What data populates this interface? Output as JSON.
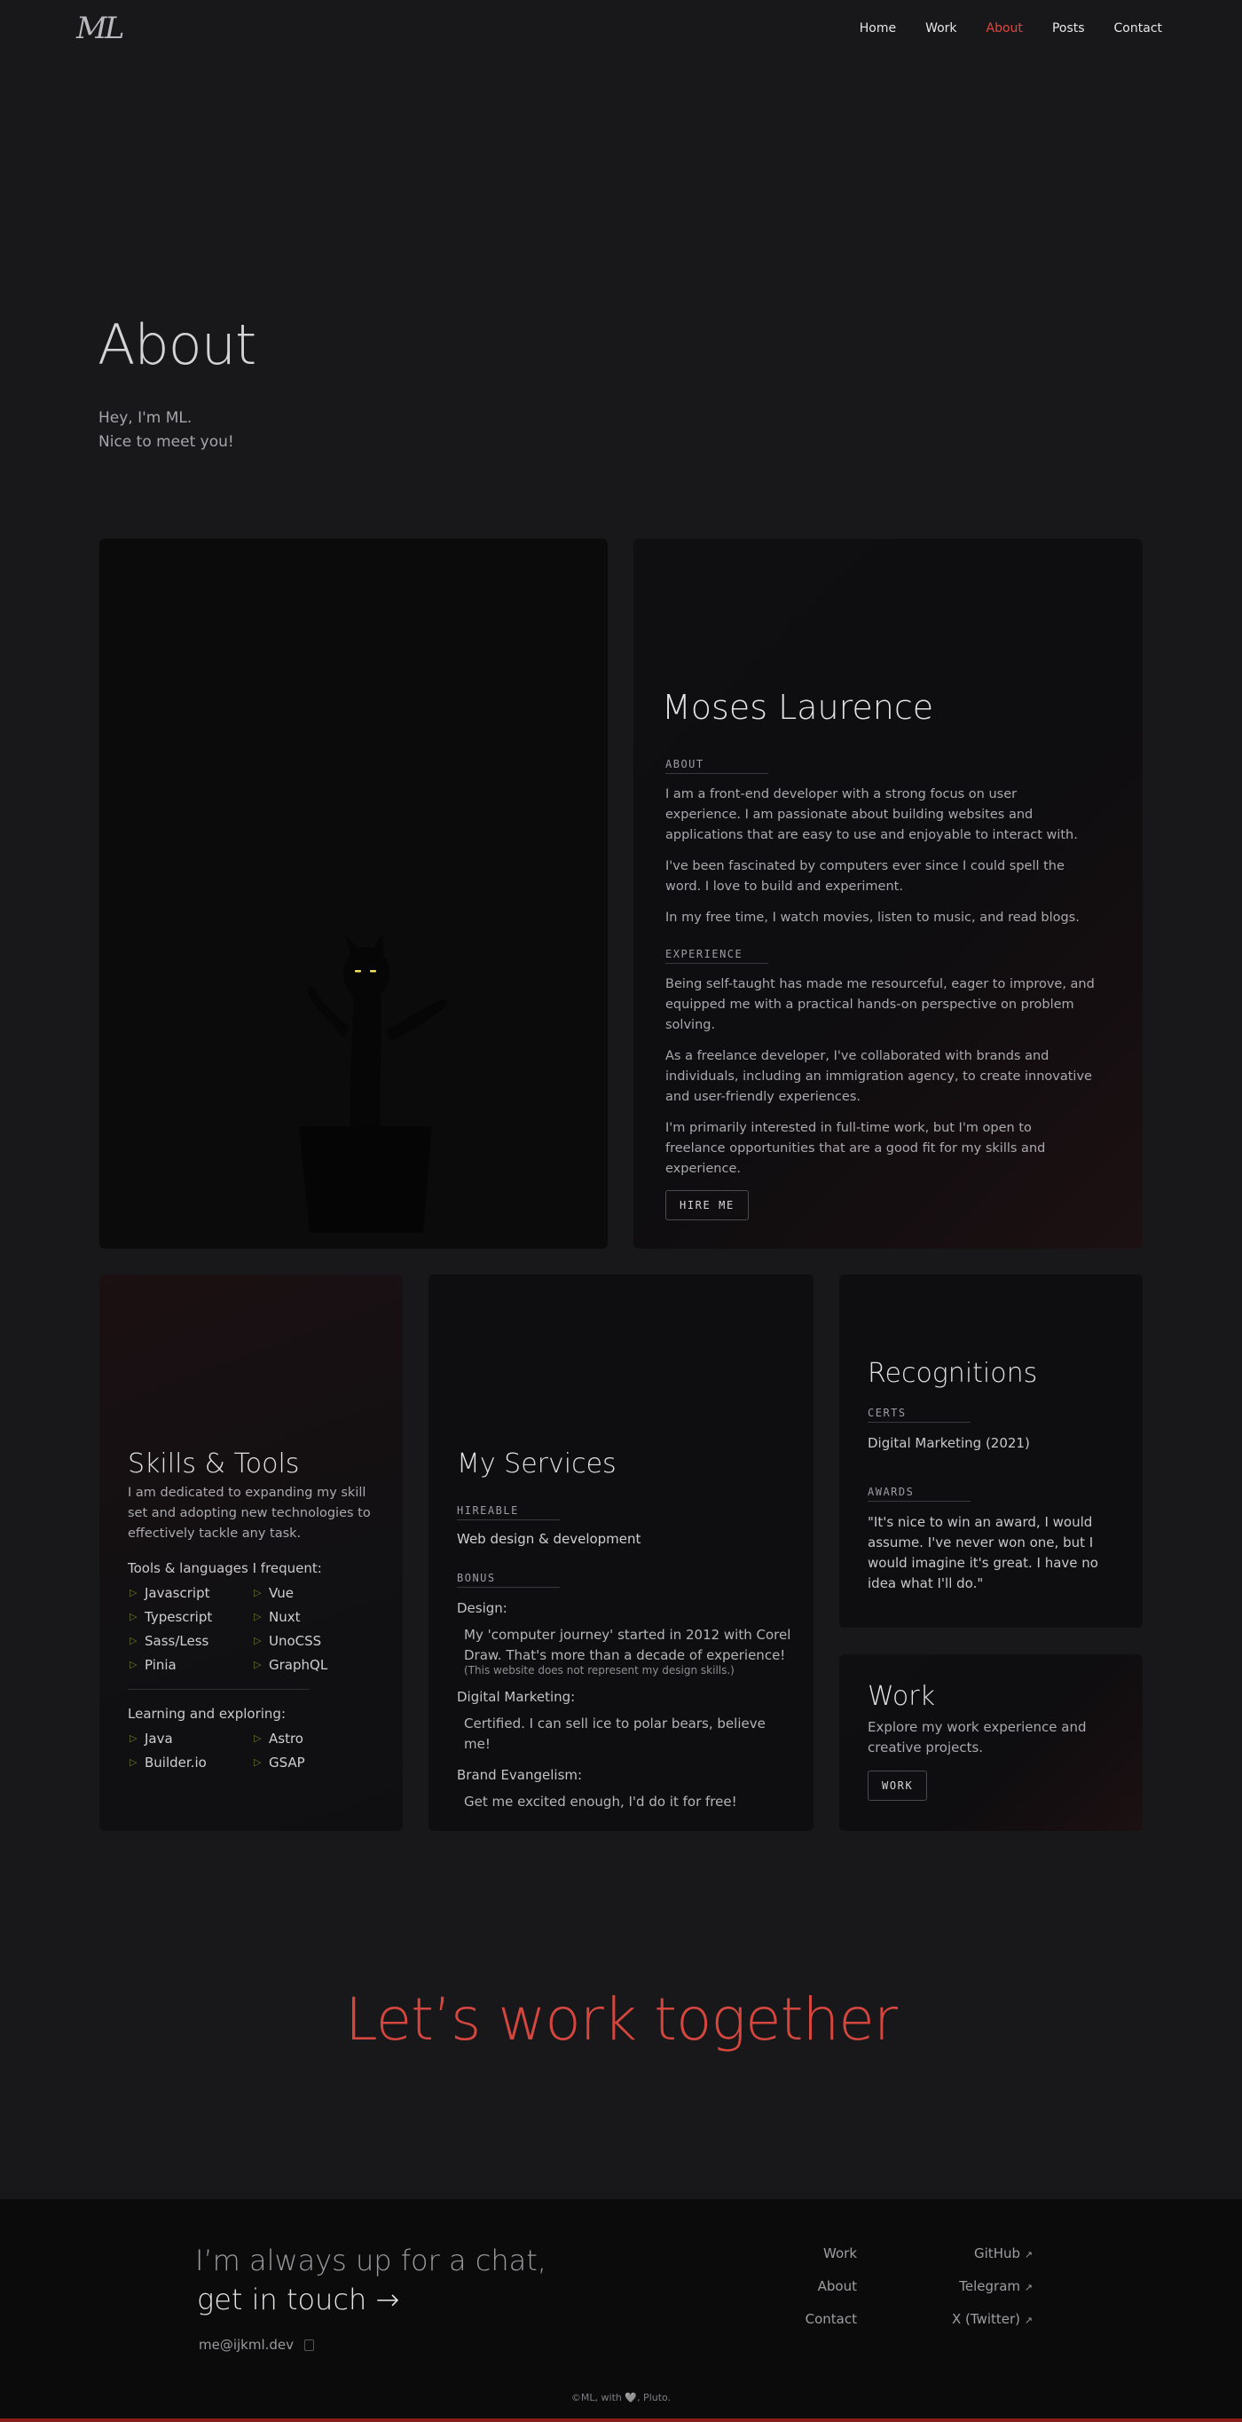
{
  "nav": {
    "logo": "ML",
    "links": [
      "Home",
      "Work",
      "About",
      "Posts",
      "Contact"
    ],
    "active": "About"
  },
  "hero": {
    "title": "About",
    "line1": "Hey, I'm ML.",
    "line2": "Nice to meet you!"
  },
  "bio": {
    "name": "Moses Laurence",
    "about_label": "ABOUT",
    "about": [
      "I am a front-end developer with a strong focus on user experience. I am passionate about building websites and applications that are easy to use and enjoyable to interact with.",
      "I've been fascinated by computers ever since I could spell the word. I love to build and experiment.",
      "In my free time, I watch movies, listen to music, and read blogs."
    ],
    "experience_label": "EXPERIENCE",
    "experience": [
      "Being self-taught has made me resourceful, eager to improve, and equipped me with a practical hands-on perspective on problem solving.",
      "As a freelance developer, I've collaborated with brands and individuals, including an immigration agency, to create innovative and user-friendly experiences.",
      "I'm primarily interested in full-time work, but I'm open to freelance opportunities that are a good fit for my skills and experience."
    ],
    "hire_label": "HIRE ME"
  },
  "skills": {
    "title": "Skills & Tools",
    "desc": "I am dedicated to expanding my skill set and adopting new technologies to effectively tackle any task.",
    "frequent_label": "Tools & languages I frequent:",
    "frequent": [
      "Javascript",
      "Vue",
      "Typescript",
      "Nuxt",
      "Sass/Less",
      "UnoCSS",
      "Pinia",
      "GraphQL"
    ],
    "learning_label": "Learning and exploring:",
    "learning": [
      "Java",
      "Astro",
      "Builder.io",
      "GSAP"
    ]
  },
  "services": {
    "title": "My Services",
    "hireable_label": "HIREABLE",
    "hireable": "Web design & development",
    "bonus_label": "BONUS",
    "design_head": "Design:",
    "design_text": "My 'computer journey' started in 2012 with Corel Draw. That's more than a decade of experience!",
    "design_note": "(This website does not represent my design skills.)",
    "marketing_head": "Digital Marketing:",
    "marketing_text": "Certified. I can sell ice to polar bears, believe me!",
    "brand_head": "Brand Evangelism:",
    "brand_text": "Get me excited enough, I'd do it for free!"
  },
  "recognitions": {
    "title": "Recognitions",
    "certs_label": "CERTS",
    "cert": "Digital Marketing (2021)",
    "awards_label": "AWARDS",
    "award_quote": "\"It's nice to win an award, I would assume. I've never won one, but I would imagine it's great. I have no idea what I'll do.\""
  },
  "work": {
    "title": "Work",
    "desc": "Explore my work experience and creative projects.",
    "button": "WORK"
  },
  "cta": "Let’s work together",
  "footer": {
    "line1": "I’m always up for a chat,",
    "line2": "get in touch →",
    "email": "me@ijkml.dev",
    "col1": [
      "Work",
      "About",
      "Contact"
    ],
    "col2": [
      "GitHub",
      "Telegram",
      "X (Twitter)"
    ],
    "external_arrow": "↗",
    "copyright": "©ML, with 🩶, Pluto."
  },
  "colors": {
    "accent": "#e0473f",
    "background": "#18181a",
    "card": "#0e0e10"
  }
}
